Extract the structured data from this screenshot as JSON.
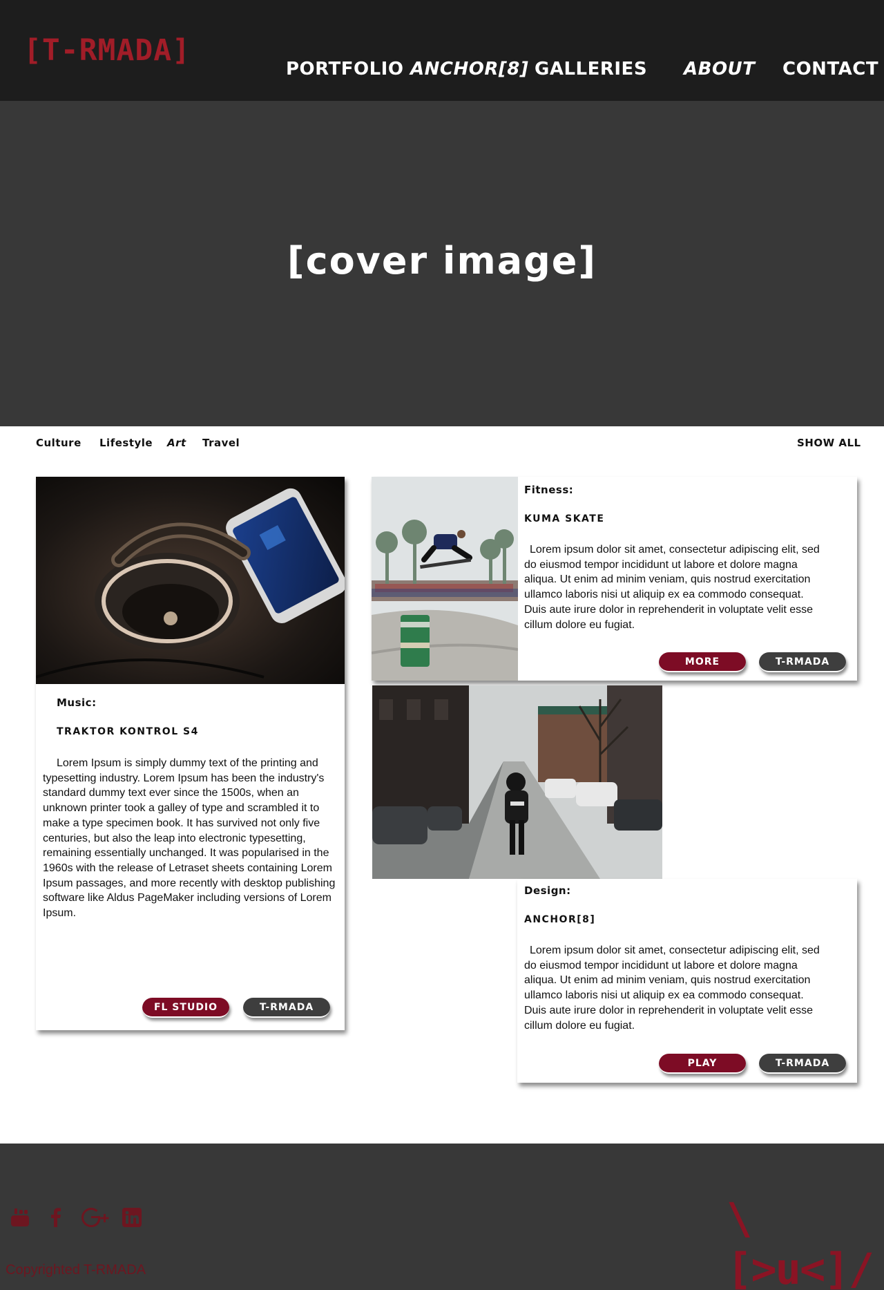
{
  "header": {
    "logo": "[T-RMADA]",
    "nav": [
      "PORTFOLIO",
      "ANCHOR[8]",
      "GALLERIES",
      "ABOUT",
      "CONTACT"
    ]
  },
  "hero": {
    "text": "[cover image]"
  },
  "filters": {
    "categories": [
      "Culture",
      "Lifestyle",
      "Art",
      "Travel"
    ],
    "show_all": "SHOW ALL"
  },
  "posts": {
    "music": {
      "category": "Music:",
      "title": "TRAKTOR KONTROL S4",
      "body": "Lorem Ipsum is simply dummy text of the printing and typesetting industry. Lorem Ipsum has been the industry's standard dummy text ever since the 1500s, when an unknown printer took a galley of type and scrambled it to make a type specimen book. It has survived not only five centuries, but also the leap into electronic typesetting, remaining essentially unchanged. It was popularised in the 1960s with the release of Letraset sheets containing Lorem Ipsum passages, and more recently with desktop publishing software like Aldus PageMaker including versions of Lorem Ipsum.",
      "buttons": [
        "FL STUDIO",
        "T-RMADA"
      ]
    },
    "fitness": {
      "category": "Fitness:",
      "title": "KUMA SKATE",
      "body": "Lorem ipsum dolor sit amet, consectetur adipiscing elit, sed do eiusmod tempor incididunt ut labore et dolore magna aliqua. Ut enim ad minim veniam, quis nostrud exercitation ullamco laboris nisi ut aliquip ex ea commodo consequat. Duis aute irure dolor in reprehenderit in voluptate velit esse cillum dolore eu fugiat.",
      "buttons": [
        "MORE",
        "T-RMADA"
      ]
    },
    "design": {
      "category": "Design:",
      "title": "ANCHOR[8]",
      "body": "Lorem ipsum dolor sit amet, consectetur adipiscing elit, sed do eiusmod tempor incididunt ut labore et dolore magna aliqua. Ut enim ad minim veniam, quis nostrud exercitation ullamco laboris nisi ut aliquip ex ea commodo consequat. Duis aute irure dolor in reprehenderit in voluptate velit esse cillum dolore eu fugiat.",
      "buttons": [
        "PLAY",
        "T-RMADA"
      ]
    }
  },
  "footer": {
    "social_icons": [
      "youtube-icon",
      "facebook-icon",
      "google-plus-icon",
      "linkedin-icon"
    ],
    "brand_mark": "\\[>u<]/",
    "copyright": "Copyrighted T-RMADA"
  },
  "colors": {
    "header_bg": "#1d1d1d",
    "hero_bg": "#383838",
    "accent_red": "#7d0c25",
    "logo_red": "#a11d28",
    "button_gray": "#3e3e3e"
  }
}
